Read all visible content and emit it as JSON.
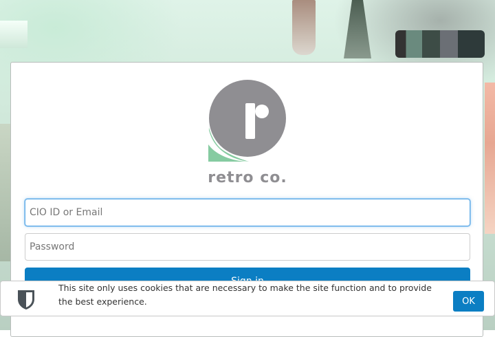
{
  "login": {
    "brand_name": "retro co.",
    "email_placeholder": "CIO ID or Email",
    "password_placeholder": "Password",
    "signin_label": "Sign in"
  },
  "cookie_banner": {
    "message": "This site only uses cookies that are necessary to make the site function and to provide the best experience.",
    "ok_label": "OK",
    "icon": "shield-icon"
  },
  "colors": {
    "primary": "#0b7ec3",
    "logo_gray": "#8f8e92",
    "logo_green": "#86cba1",
    "focus": "#66afe9"
  }
}
